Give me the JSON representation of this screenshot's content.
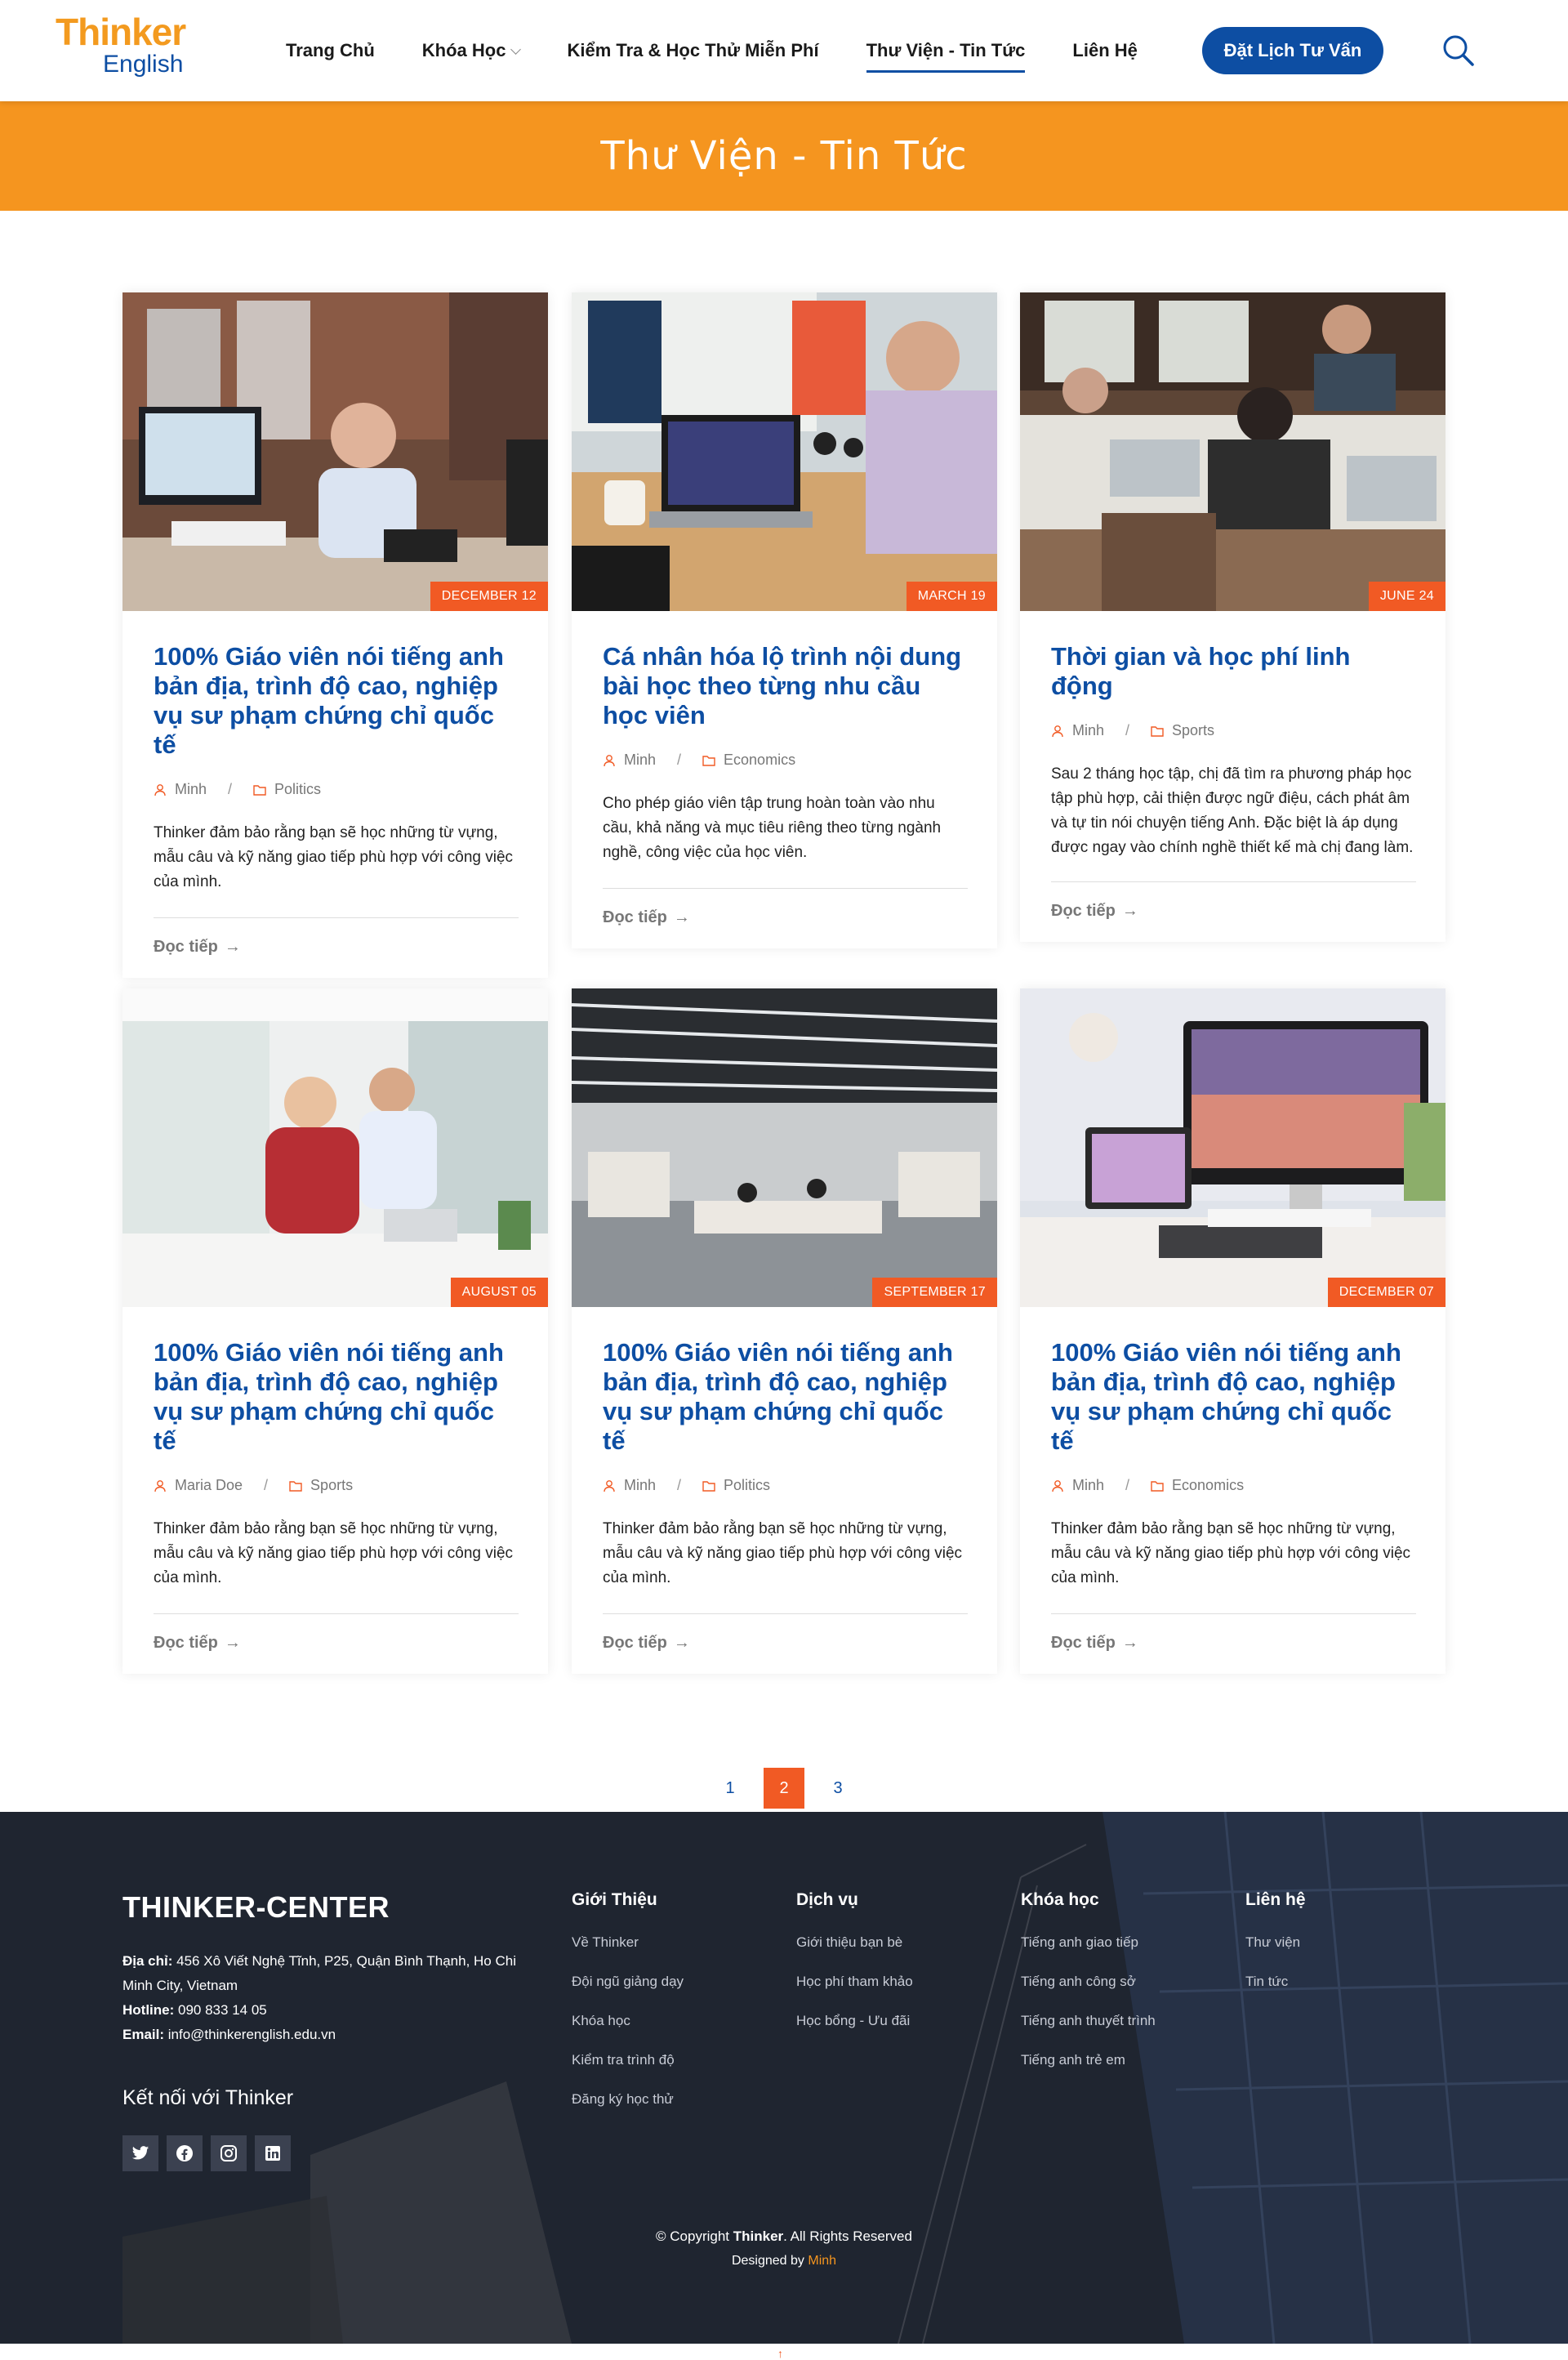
{
  "header": {
    "logo_top": "Thinker",
    "logo_bottom": "English",
    "nav": [
      "Trang Chủ",
      "Khóa Học",
      "Kiểm Tra & Học Thử Miễn Phí",
      "Thư Viện - Tin Tức",
      "Liên Hệ"
    ],
    "cta": "Đặt Lịch Tư Vấn"
  },
  "banner": {
    "title": "Thư Viện - Tin Tức"
  },
  "posts": [
    {
      "date": "DECEMBER 12",
      "title": "100% Giáo viên nói tiếng anh bản địa, trình độ cao, nghiệp vụ sư phạm chứng chỉ quốc tế",
      "author": "Minh",
      "category": "Politics",
      "excerpt": "Thinker đảm bảo rằng bạn sẽ học những từ vựng, mẫu câu và kỹ năng giao tiếp phù hợp với công việc của mình.",
      "more": "Đọc tiếp"
    },
    {
      "date": "MARCH 19",
      "title": "Cá nhân hóa lộ trình nội dung bài học theo từng nhu cầu học viên",
      "author": "Minh",
      "category": "Economics",
      "excerpt": "Cho phép giáo viên tập trung hoàn toàn vào nhu cầu, khả năng và mục tiêu riêng theo từng ngành nghề, công việc của học viên.",
      "more": "Đọc tiếp"
    },
    {
      "date": "JUNE 24",
      "title": "Thời gian và học phí linh động",
      "author": "Minh",
      "category": "Sports",
      "excerpt": "Sau 2 tháng học tập, chị đã tìm ra phương pháp học tập phù hợp, cải thiện được ngữ điệu, cách phát âm và tự tin nói chuyện tiếng Anh. Đặc biệt là áp dụng được ngay vào chính nghề thiết kế mà chị đang làm.",
      "more": "Đọc tiếp"
    },
    {
      "date": "AUGUST 05",
      "title": "100% Giáo viên nói tiếng anh bản địa, trình độ cao, nghiệp vụ sư phạm chứng chỉ quốc tế",
      "author": "Maria Doe",
      "category": "Sports",
      "excerpt": "Thinker đảm bảo rằng bạn sẽ học những từ vựng, mẫu câu và kỹ năng giao tiếp phù hợp với công việc của mình.",
      "more": "Đọc tiếp"
    },
    {
      "date": "SEPTEMBER 17",
      "title": "100% Giáo viên nói tiếng anh bản địa, trình độ cao, nghiệp vụ sư phạm chứng chỉ quốc tế",
      "author": "Minh",
      "category": "Politics",
      "excerpt": "Thinker đảm bảo rằng bạn sẽ học những từ vựng, mẫu câu và kỹ năng giao tiếp phù hợp với công việc của mình.",
      "more": "Đọc tiếp"
    },
    {
      "date": "DECEMBER 07",
      "title": "100% Giáo viên nói tiếng anh bản địa, trình độ cao, nghiệp vụ sư phạm chứng chỉ quốc tế",
      "author": "Minh",
      "category": "Economics",
      "excerpt": "Thinker đảm bảo rằng bạn sẽ học những từ vựng, mẫu câu và kỹ năng giao tiếp phù hợp với công việc của mình.",
      "more": "Đọc tiếp"
    }
  ],
  "pagination": {
    "pages": [
      "1",
      "2",
      "3"
    ],
    "current": "2"
  },
  "footer": {
    "brand": "THINKER-CENTER",
    "address_label": "Địa chỉ:",
    "address": "456 Xô Viết Nghệ Tĩnh, P25, Quận Bình Thạnh, Ho Chi Minh City, Vietnam",
    "hotline_label": "Hotline:",
    "hotline": "090 833 14 05",
    "email_label": "Email:",
    "email": "info@thinkerenglish.edu.vn",
    "connect": "Kết nối với Thinker",
    "columns": [
      {
        "title": "Giới Thiệu",
        "links": [
          "Về Thinker",
          "Đội ngũ giảng dạy",
          "Khóa học",
          "Kiểm tra trình độ",
          "Đăng ký học thử"
        ]
      },
      {
        "title": "Dịch vụ",
        "links": [
          "Giới thiệu bạn bè",
          "Học phí tham khảo",
          "Học bổng - Ưu đãi"
        ]
      },
      {
        "title": "Khóa học",
        "links": [
          "Tiếng anh giao tiếp",
          "Tiếng anh công sở",
          "Tiếng anh thuyết trình",
          "Tiếng anh trẻ em"
        ]
      },
      {
        "title": "Liên hệ",
        "links": [
          "Thư viện",
          "Tin tức"
        ]
      }
    ],
    "copyright_pre": "© Copyright",
    "copyright_brand": "Thinker",
    "copyright_post": ". All Rights Reserved",
    "designed_pre": "Designed by",
    "designed_by": "Minh"
  },
  "colors": {
    "primary": "#0d4ea3",
    "accent": "#f5951f",
    "date_badge": "#f15a24",
    "footer_bg": "#1f2530"
  }
}
